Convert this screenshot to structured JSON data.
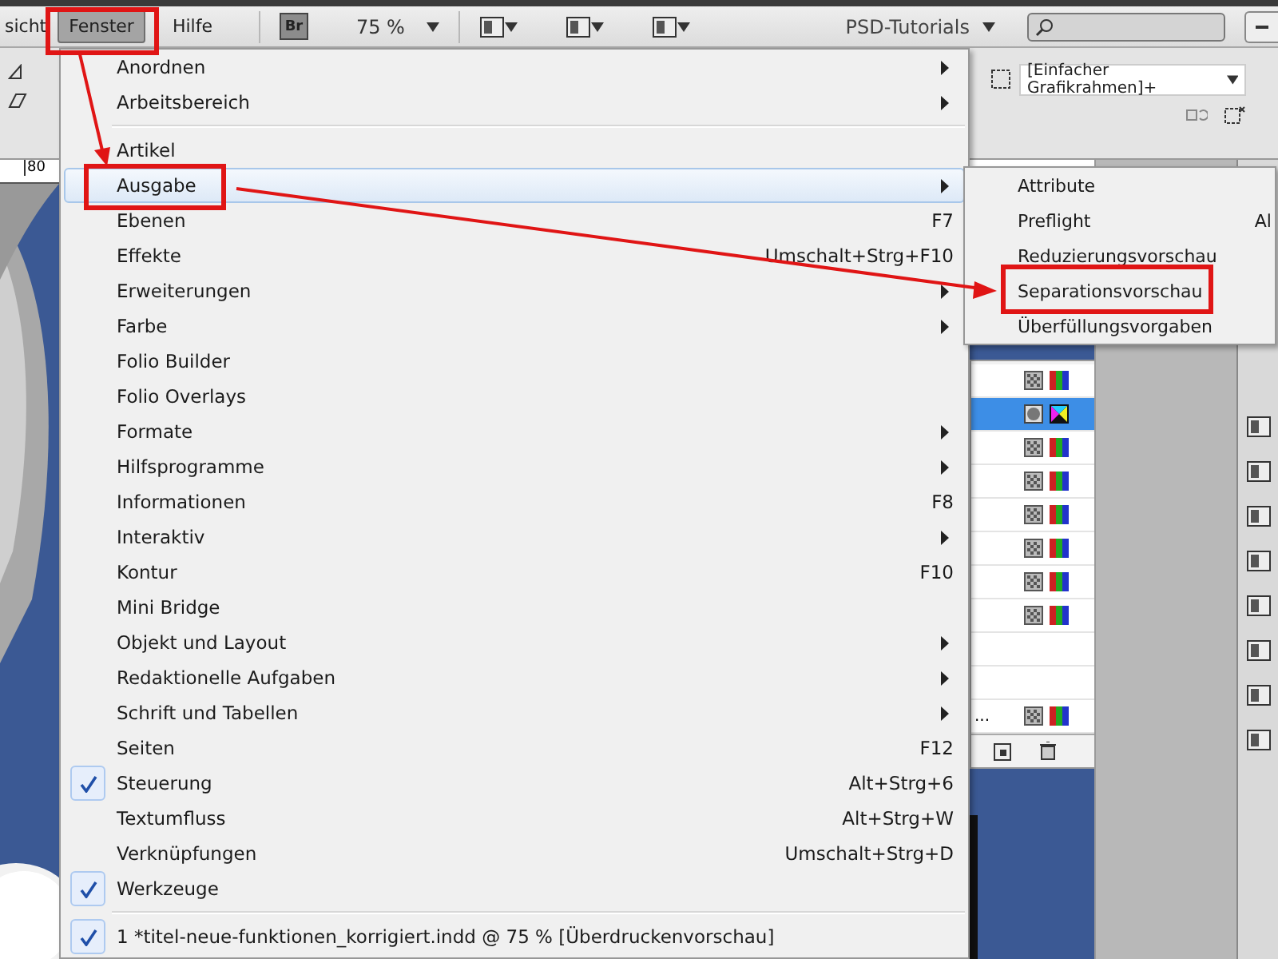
{
  "menubar": {
    "items": [
      {
        "label": "sicht",
        "selected": false
      },
      {
        "label": "Fenster",
        "selected": true
      },
      {
        "label": "Hilfe",
        "selected": false
      }
    ],
    "bridge": "Br",
    "zoom": "75 %",
    "workspace": "PSD-Tutorials"
  },
  "control_panel": {
    "frame_style": "[Einfacher Grafikrahmen]+"
  },
  "ruler": {
    "label": "80"
  },
  "window_menu": [
    {
      "kind": "item",
      "label": "Anordnen",
      "submenu": true,
      "checked": false,
      "selected": false
    },
    {
      "kind": "item",
      "label": "Arbeitsbereich",
      "submenu": true,
      "checked": false,
      "selected": false
    },
    {
      "kind": "separator"
    },
    {
      "kind": "item",
      "label": "Artikel",
      "submenu": false,
      "checked": false,
      "selected": false
    },
    {
      "kind": "item",
      "label": "Ausgabe",
      "submenu": true,
      "checked": false,
      "selected": true
    },
    {
      "kind": "item",
      "label": "Ebenen",
      "shortcut": "F7",
      "submenu": false,
      "checked": false,
      "selected": false
    },
    {
      "kind": "item",
      "label": "Effekte",
      "shortcut": "Umschalt+Strg+F10",
      "submenu": false,
      "checked": false,
      "selected": false
    },
    {
      "kind": "item",
      "label": "Erweiterungen",
      "submenu": true,
      "checked": false,
      "selected": false
    },
    {
      "kind": "item",
      "label": "Farbe",
      "submenu": true,
      "checked": false,
      "selected": false
    },
    {
      "kind": "item",
      "label": "Folio Builder",
      "submenu": false,
      "checked": false,
      "selected": false
    },
    {
      "kind": "item",
      "label": "Folio Overlays",
      "submenu": false,
      "checked": false,
      "selected": false
    },
    {
      "kind": "item",
      "label": "Formate",
      "submenu": true,
      "checked": false,
      "selected": false
    },
    {
      "kind": "item",
      "label": "Hilfsprogramme",
      "submenu": true,
      "checked": false,
      "selected": false
    },
    {
      "kind": "item",
      "label": "Informationen",
      "shortcut": "F8",
      "submenu": false,
      "checked": false,
      "selected": false
    },
    {
      "kind": "item",
      "label": "Interaktiv",
      "submenu": true,
      "checked": false,
      "selected": false
    },
    {
      "kind": "item",
      "label": "Kontur",
      "shortcut": "F10",
      "submenu": false,
      "checked": false,
      "selected": false
    },
    {
      "kind": "item",
      "label": "Mini Bridge",
      "submenu": false,
      "checked": false,
      "selected": false
    },
    {
      "kind": "item",
      "label": "Objekt und Layout",
      "submenu": true,
      "checked": false,
      "selected": false
    },
    {
      "kind": "item",
      "label": "Redaktionelle Aufgaben",
      "submenu": true,
      "checked": false,
      "selected": false
    },
    {
      "kind": "item",
      "label": "Schrift und Tabellen",
      "submenu": true,
      "checked": false,
      "selected": false
    },
    {
      "kind": "item",
      "label": "Seiten",
      "shortcut": "F12",
      "submenu": false,
      "checked": false,
      "selected": false
    },
    {
      "kind": "item",
      "label": "Steuerung",
      "shortcut": "Alt+Strg+6",
      "submenu": false,
      "checked": true,
      "selected": false
    },
    {
      "kind": "item",
      "label": "Textumfluss",
      "shortcut": "Alt+Strg+W",
      "submenu": false,
      "checked": false,
      "selected": false
    },
    {
      "kind": "item",
      "label": "Verknüpfungen",
      "shortcut": "Umschalt+Strg+D",
      "submenu": false,
      "checked": false,
      "selected": false
    },
    {
      "kind": "item",
      "label": "Werkzeuge",
      "submenu": false,
      "checked": true,
      "selected": false
    },
    {
      "kind": "separator"
    },
    {
      "kind": "item",
      "label": "1 *titel-neue-funktionen_korrigiert.indd @ 75 % [Überdruckenvorschau]",
      "submenu": false,
      "checked": true,
      "selected": false
    }
  ],
  "output_submenu": [
    {
      "label": "Attribute",
      "selected": false
    },
    {
      "label": "Preflight",
      "shortcut": "Al",
      "selected": false
    },
    {
      "label": "Reduzierungsvorschau",
      "selected": false
    },
    {
      "label": "Separationsvorschau",
      "selected": false
    },
    {
      "label": "Überfüllungsvorgaben",
      "selected": false
    }
  ],
  "swatch_rows": [
    {
      "kind": "swatch",
      "selected": false
    },
    {
      "kind": "special",
      "selected": true
    },
    {
      "kind": "swatch",
      "selected": false
    },
    {
      "kind": "swatch",
      "selected": false
    },
    {
      "kind": "swatch",
      "selected": false
    },
    {
      "kind": "swatch",
      "selected": false
    },
    {
      "kind": "swatch",
      "selected": false
    },
    {
      "kind": "swatch",
      "selected": false
    },
    {
      "kind": "blank",
      "selected": false
    },
    {
      "kind": "blank",
      "selected": false
    },
    {
      "kind": "swatch",
      "selected": false,
      "name": "..."
    }
  ]
}
